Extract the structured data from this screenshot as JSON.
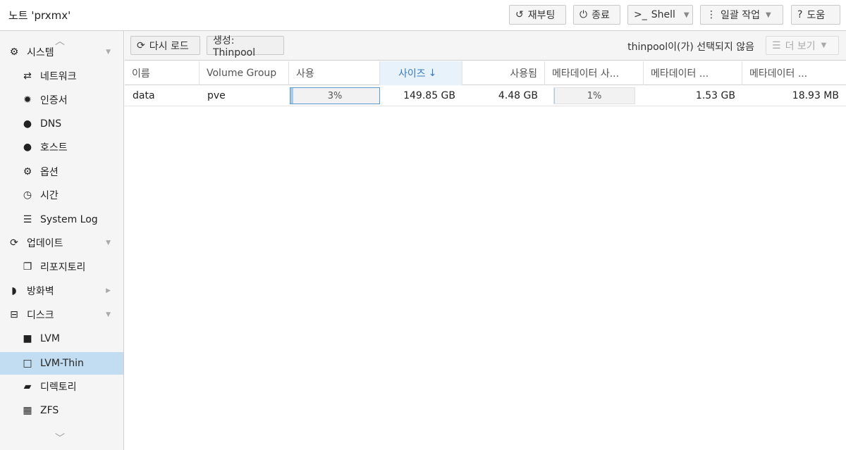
{
  "header": {
    "title": "노트 'prxmx'",
    "reboot_label": "재부팅",
    "shutdown_label": "종료",
    "shell_label": "Shell",
    "bulk_label": "일괄 작업",
    "help_label": "도움"
  },
  "sidebar": {
    "items": [
      {
        "label": "시스템",
        "icon": "gears-icon"
      },
      {
        "label": "네트워크",
        "icon": "exchange-icon"
      },
      {
        "label": "인증서",
        "icon": "certificate-icon"
      },
      {
        "label": "DNS",
        "icon": "globe-icon"
      },
      {
        "label": "호스트",
        "icon": "globe-icon"
      },
      {
        "label": "옵션",
        "icon": "gear-icon"
      },
      {
        "label": "시간",
        "icon": "clock-icon"
      },
      {
        "label": "System Log",
        "icon": "list-icon"
      },
      {
        "label": "업데이트",
        "icon": "refresh-icon"
      },
      {
        "label": "리포지토리",
        "icon": "files-icon"
      },
      {
        "label": "방화벽",
        "icon": "shield-icon"
      },
      {
        "label": "디스크",
        "icon": "hdd-icon"
      },
      {
        "label": "LVM",
        "icon": "square-icon"
      },
      {
        "label": "LVM-Thin",
        "icon": "square-outline-icon"
      },
      {
        "label": "디렉토리",
        "icon": "folder-icon"
      },
      {
        "label": "ZFS",
        "icon": "th-large-icon"
      }
    ],
    "selected": "LVM-Thin"
  },
  "toolbar": {
    "reload_label": "다시 로드",
    "create_label": "생성: Thinpool",
    "status_text": "thinpool이(가) 선택되지 않음",
    "more_label": "더 보기"
  },
  "grid": {
    "columns": [
      "이름",
      "Volume Group",
      "사용",
      "사이즈",
      "사용됨",
      "메타데이터 사...",
      "메타데이터 ...",
      "메타데이터 ..."
    ],
    "sort_indicator": "↓",
    "rows": [
      {
        "name": "data",
        "vg": "pve",
        "usage_percent": 3,
        "usage_label": "3%",
        "size": "149.85 GB",
        "used": "4.48 GB",
        "meta_usage_percent": 1,
        "meta_usage_label": "1%",
        "meta_used": "1.53 GB",
        "meta_size": "18.93 MB"
      }
    ]
  },
  "colors": {
    "selected_bg": "#c2ddf2",
    "progress_fill": "#a9cbe8",
    "sorted_header": "#3a7bbf"
  }
}
